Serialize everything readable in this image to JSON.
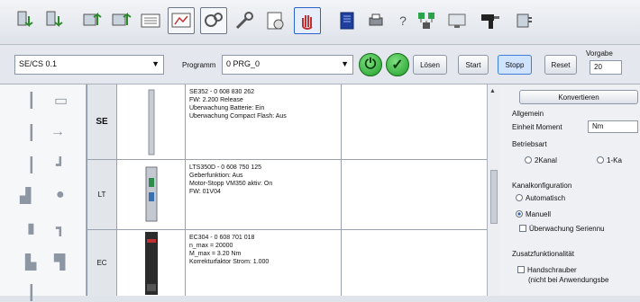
{
  "toolbar": {
    "icons": [
      "download-a-icon",
      "download-b-icon",
      "upload-a-icon",
      "upload-b-icon",
      "terminal-icon",
      "monitor-icon",
      "gears-icon",
      "wrench-icon",
      "parameters-icon",
      "hand-icon",
      "book-icon",
      "printer-icon",
      "question-icon",
      "network-icon",
      "screen-icon",
      "screwdriver-icon",
      "device-icon"
    ]
  },
  "controls": {
    "device_value": "SE/CS 0.1",
    "program_label": "Programm",
    "program_value": "0 PRG_0",
    "btn_loesen": "Lösen",
    "btn_start": "Start",
    "btn_stopp": "Stopp",
    "btn_reset": "Reset",
    "vorgabe_label": "Vorgabe",
    "vorgabe_value": "20"
  },
  "rows": [
    {
      "code": "SE",
      "lines": [
        "SE352 - 0 608 830 262",
        "FW: 2.200 Release",
        "Überwachung Batterie: Ein",
        "Überwachung Compact Flash: Aus"
      ]
    },
    {
      "code": "LT",
      "lines": [
        "LTS350D - 0 608 750 125",
        "Geberfunktion: Aus",
        "Motor-Stopp VM350 aktiv: On",
        "FW: 01V04"
      ]
    },
    {
      "code": "EC",
      "lines": [
        "EC304 - 0 608 701 018",
        "n_max = 20000",
        "M_max = 3.20 Nm",
        "Korrekturfaktor Strom: 1.000"
      ]
    }
  ],
  "panel": {
    "convert_button": "Konvertieren",
    "allgemein": "Allgemein",
    "einheit_label": "Einheit Moment",
    "einheit_value": "Nm",
    "betriebsart": "Betriebsart",
    "radio_2kanal": "2Kanal",
    "radio_1kanal": "1-Ka",
    "kanalkonfig": "Kanalkonfiguration",
    "radio_auto": "Automatisch",
    "radio_manuell": "Manuell",
    "cb_seriennr": "Überwachung Seriennu",
    "zusatz": "Zusatzfunktionalität",
    "cb_handschrauber": "Handschrauber",
    "cb_handschrauber_sub": "(nicht bei Anwendungsbe"
  }
}
